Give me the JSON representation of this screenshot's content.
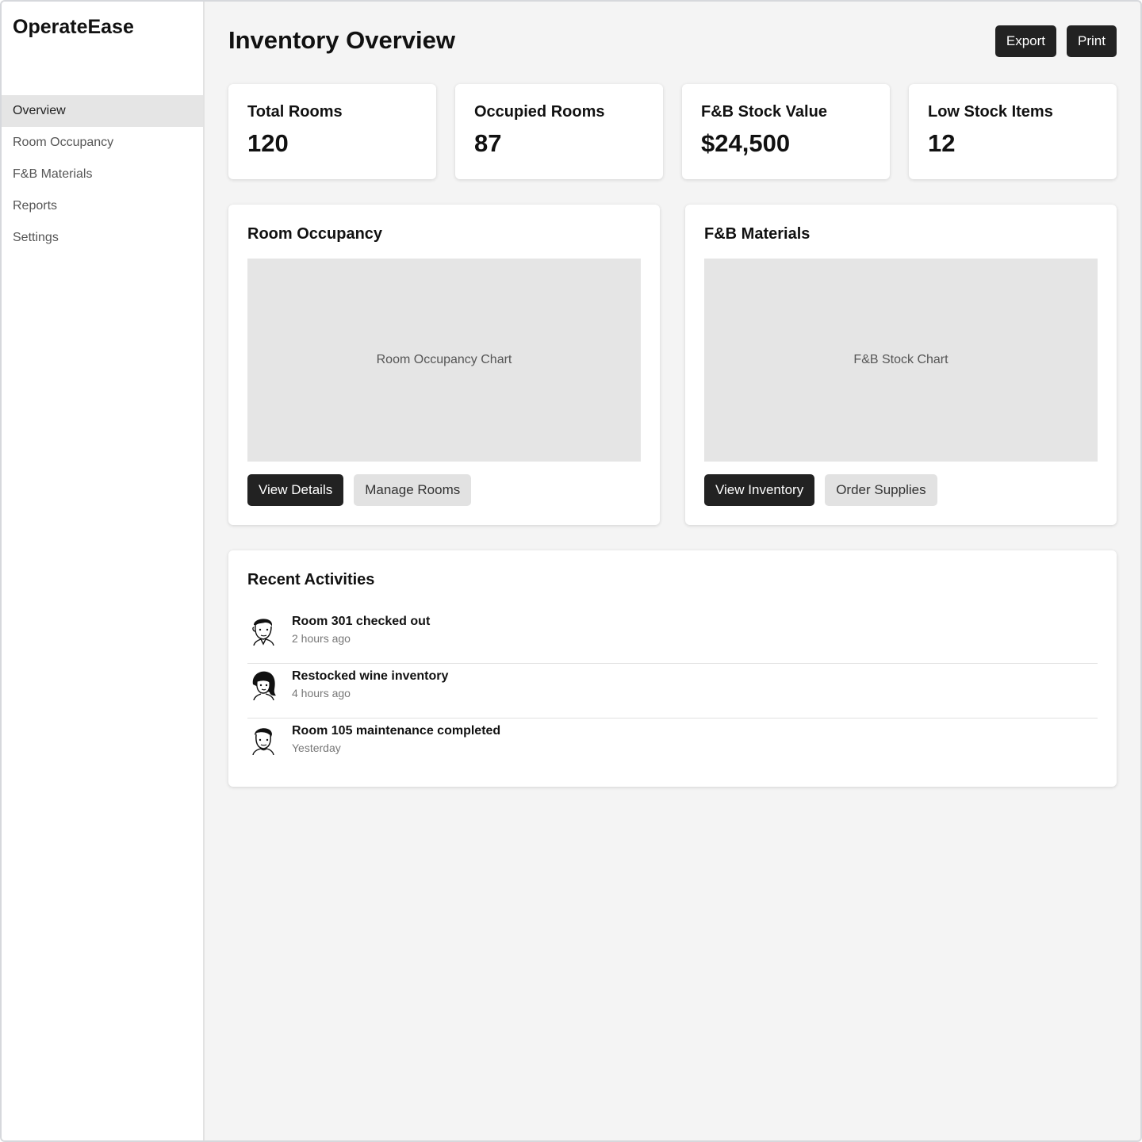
{
  "app": {
    "name": "OperateEase"
  },
  "sidebar": {
    "items": [
      {
        "label": "Overview",
        "active": true
      },
      {
        "label": "Room Occupancy"
      },
      {
        "label": "F&B Materials"
      },
      {
        "label": "Reports"
      },
      {
        "label": "Settings"
      }
    ]
  },
  "header": {
    "title": "Inventory Overview",
    "export_label": "Export",
    "print_label": "Print"
  },
  "stats": [
    {
      "label": "Total Rooms",
      "value": "120"
    },
    {
      "label": "Occupied Rooms",
      "value": "87"
    },
    {
      "label": "F&B Stock Value",
      "value": "$24,500"
    },
    {
      "label": "Low Stock Items",
      "value": "12"
    }
  ],
  "panels": {
    "occupancy": {
      "title": "Room Occupancy",
      "chart_placeholder": "Room Occupancy Chart",
      "primary_button": "View Details",
      "secondary_button": "Manage Rooms"
    },
    "fnb": {
      "title": "F&B Materials",
      "chart_placeholder": "F&B Stock Chart",
      "primary_button": "View Inventory",
      "secondary_button": "Order Supplies"
    }
  },
  "activities": {
    "title": "Recent Activities",
    "items": [
      {
        "title": "Room 301 checked out",
        "time": "2 hours ago",
        "avatar": "man-avatar-icon"
      },
      {
        "title": "Restocked wine inventory",
        "time": "4 hours ago",
        "avatar": "woman-avatar-icon"
      },
      {
        "title": "Room 105 maintenance completed",
        "time": "Yesterday",
        "avatar": "man-avatar-icon"
      }
    ]
  },
  "colors": {
    "primary_button": "#222222",
    "secondary_button": "#e2e2e2",
    "background": "#f4f4f4",
    "active_nav": "#e5e5e5"
  }
}
